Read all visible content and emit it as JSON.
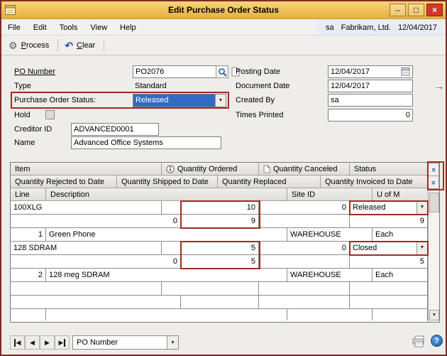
{
  "window": {
    "title": "Edit Purchase Order Status"
  },
  "session": {
    "user": "sa",
    "company": "Fabrikam, Ltd.",
    "date": "12/04/2017"
  },
  "menu": {
    "items": [
      "File",
      "Edit",
      "Tools",
      "View",
      "Help"
    ]
  },
  "toolbar": {
    "process_label": "Process",
    "clear_label": "Clear"
  },
  "form": {
    "po_number": {
      "label": "PO Number",
      "value": "PO2076"
    },
    "type": {
      "label": "Type",
      "value": "Standard"
    },
    "status": {
      "label": "Purchase Order Status:",
      "value": "Released"
    },
    "hold": {
      "label": "Hold"
    },
    "creditor": {
      "label": "Creditor ID",
      "value": "ADVANCED0001"
    },
    "name": {
      "label": "Name",
      "value": "Advanced Office Systems"
    },
    "posting_date": {
      "label": "Posting Date",
      "value": "12/04/2017"
    },
    "document_date": {
      "label": "Document Date",
      "value": "12/04/2017"
    },
    "created_by": {
      "label": "Created By",
      "value": "sa"
    },
    "times_printed": {
      "label": "Times Printed",
      "value": "0"
    }
  },
  "grid": {
    "h1": [
      "Item",
      "Quantity Ordered",
      "Quantity Canceled",
      "Status"
    ],
    "h2": [
      "Quantity Rejected to Date",
      "Quantity Shipped to Date",
      "Quantity Replaced",
      "Quantity Invoiced to Date"
    ],
    "h3": [
      "Line",
      "Description",
      "Site ID",
      "U of M"
    ],
    "items": [
      {
        "item": "100XLG",
        "qty_ordered": "10",
        "qty_canceled": "0",
        "status": "Released",
        "qty_rejected": "0",
        "qty_shipped": "9",
        "qty_replaced": "",
        "qty_invoiced": "9",
        "line": "1",
        "description": "Green Phone",
        "site_id": "WAREHOUSE",
        "uom": "Each"
      },
      {
        "item": "128 SDRAM",
        "qty_ordered": "5",
        "qty_canceled": "0",
        "status": "Closed",
        "qty_rejected": "0",
        "qty_shipped": "5",
        "qty_replaced": "",
        "qty_invoiced": "5",
        "line": "2",
        "description": "128 meg SDRAM",
        "site_id": "WAREHOUSE",
        "uom": "Each"
      }
    ]
  },
  "footer": {
    "browse_by": "PO Number"
  },
  "icons": {
    "minimize": "–",
    "maximize": "□",
    "close": "×",
    "process": "⚙",
    "clear": "↶",
    "expansion_arrow": "→",
    "dropdown_arrow": "▼",
    "chevron_double": "«",
    "scroll_down": "▼",
    "nav_prev": "◀",
    "nav_next": "▶",
    "help": "?"
  }
}
